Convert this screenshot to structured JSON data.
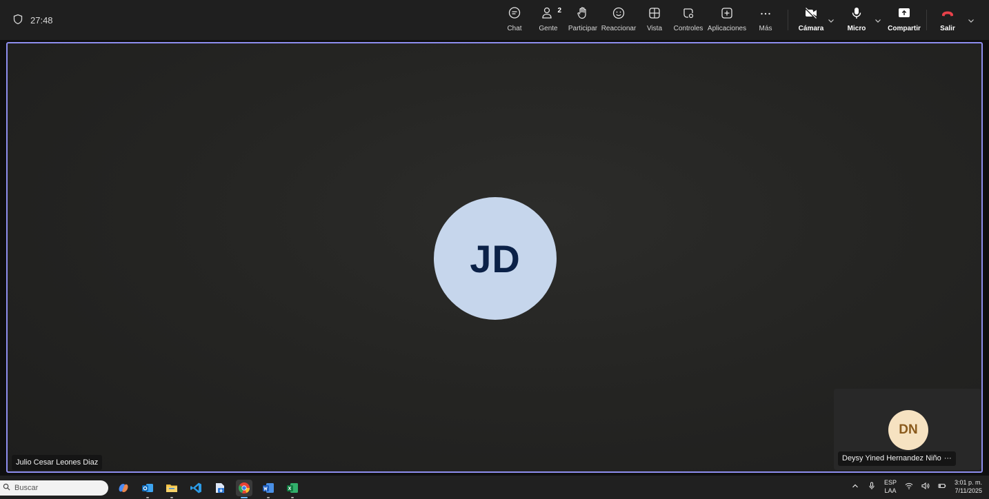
{
  "timer": {
    "icon": "shield-icon",
    "text": "27:48"
  },
  "toolbar": {
    "chat": "Chat",
    "people": "Gente",
    "people_count": "2",
    "raise": "Participar",
    "react": "Reaccionar",
    "view": "Vista",
    "controls": "Controles",
    "apps": "Aplicaciones",
    "more": "Más",
    "camera": "Cámara",
    "mic": "Micro",
    "share": "Compartir",
    "leave": "Salir"
  },
  "colors": {
    "stage_border": "#8f8ff0",
    "leave": "#e8414a",
    "main_avatar_bg": "#c6d6ec",
    "self_avatar_bg": "#f6e2c1"
  },
  "main_participant": {
    "initials": "JD",
    "name": "Julio Cesar Leones Diaz"
  },
  "self_participant": {
    "initials": "DN",
    "name": "Deysy Yined Hernandez Niño",
    "more": "···"
  },
  "taskbar": {
    "search_placeholder": "Buscar",
    "apps": [
      "copilot-icon",
      "outlook-icon",
      "file-explorer-icon",
      "vscode-icon",
      "app-installer-icon",
      "chrome-icon",
      "word-icon",
      "excel-icon"
    ],
    "lang_top": "ESP",
    "lang_bottom": "LAA",
    "time": "3:01 p. m.",
    "date": "7/11/2025"
  }
}
